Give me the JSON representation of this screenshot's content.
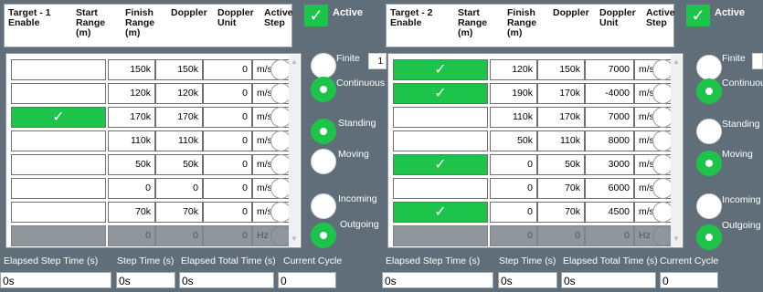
{
  "panels": [
    {
      "headers": [
        "Target - 1 Enable",
        "Start Range (m)",
        "Finish Range (m)",
        "Doppler",
        "Doppler Unit",
        "Active Step"
      ],
      "active_label": "Active",
      "finite_label": "Finite",
      "finite_value": "1",
      "continuous_label": "Continuous",
      "standing_label": "Standing",
      "moving_label": "Moving",
      "incoming_label": "Incoming",
      "outgoing_label": "Outgoing",
      "rows": [
        {
          "enabled": false,
          "start": "150k",
          "finish": "150k",
          "doppler": "0",
          "unit": "m/s"
        },
        {
          "enabled": false,
          "start": "120k",
          "finish": "120k",
          "doppler": "0",
          "unit": "m/s"
        },
        {
          "enabled": true,
          "start": "170k",
          "finish": "170k",
          "doppler": "0",
          "unit": "m/s"
        },
        {
          "enabled": false,
          "start": "110k",
          "finish": "110k",
          "doppler": "0",
          "unit": "m/s"
        },
        {
          "enabled": false,
          "start": "50k",
          "finish": "50k",
          "doppler": "0",
          "unit": "m/s"
        },
        {
          "enabled": false,
          "start": "0",
          "finish": "0",
          "doppler": "0",
          "unit": "m/s"
        },
        {
          "enabled": false,
          "start": "70k",
          "finish": "70k",
          "doppler": "0",
          "unit": "m/s"
        },
        {
          "enabled": false,
          "start": "0",
          "finish": "0",
          "doppler": "0",
          "unit": "Hz",
          "disabled": true
        }
      ],
      "footer": {
        "elapsed_step_label": "Elapsed Step Time (s)",
        "step_time_label": "Step Time (s)",
        "elapsed_total_label": "Elapsed Total Time (s)",
        "current_cycle_label": "Current Cycle",
        "elapsed_step": "0s",
        "step_time": "0s",
        "elapsed_total": "0s",
        "current_cycle": "0"
      }
    },
    {
      "headers": [
        "Target - 2 Enable",
        "Start Range (m)",
        "Finish Range (m)",
        "Doppler",
        "Doppler Unit",
        "Active Step"
      ],
      "active_label": "Active",
      "finite_label": "Finite",
      "finite_value": "",
      "continuous_label": "Continuous",
      "standing_label": "Standing",
      "moving_label": "Moving",
      "incoming_label": "Incoming",
      "outgoing_label": "Outgoing",
      "rows": [
        {
          "enabled": true,
          "start": "120k",
          "finish": "150k",
          "doppler": "7000",
          "unit": "m/s"
        },
        {
          "enabled": true,
          "start": "190k",
          "finish": "170k",
          "doppler": "-4000",
          "unit": "m/s"
        },
        {
          "enabled": false,
          "start": "110k",
          "finish": "170k",
          "doppler": "7000",
          "unit": "m/s"
        },
        {
          "enabled": false,
          "start": "50k",
          "finish": "110k",
          "doppler": "8000",
          "unit": "m/s"
        },
        {
          "enabled": true,
          "start": "0",
          "finish": "50k",
          "doppler": "3000",
          "unit": "m/s"
        },
        {
          "enabled": false,
          "start": "0",
          "finish": "70k",
          "doppler": "6000",
          "unit": "m/s"
        },
        {
          "enabled": true,
          "start": "0",
          "finish": "70k",
          "doppler": "4500",
          "unit": "m/s"
        },
        {
          "enabled": false,
          "start": "0",
          "finish": "0",
          "doppler": "0",
          "unit": "Hz",
          "disabled": true
        }
      ],
      "footer": {
        "elapsed_step_label": "Elapsed Step Time (s)",
        "step_time_label": "Step Time (s)",
        "elapsed_total_label": "Elapsed Total Time (s)",
        "current_cycle_label": "Current Cycle",
        "elapsed_step": "0s",
        "step_time": "0s",
        "elapsed_total": "0s",
        "current_cycle": "0"
      }
    }
  ],
  "icons": {
    "check": "check-icon",
    "scroll_up": "scroll-up-icon",
    "scroll_down": "scroll-down-icon"
  },
  "colors": {
    "background": "#5f6e79",
    "accent_green": "#1cc44a"
  }
}
